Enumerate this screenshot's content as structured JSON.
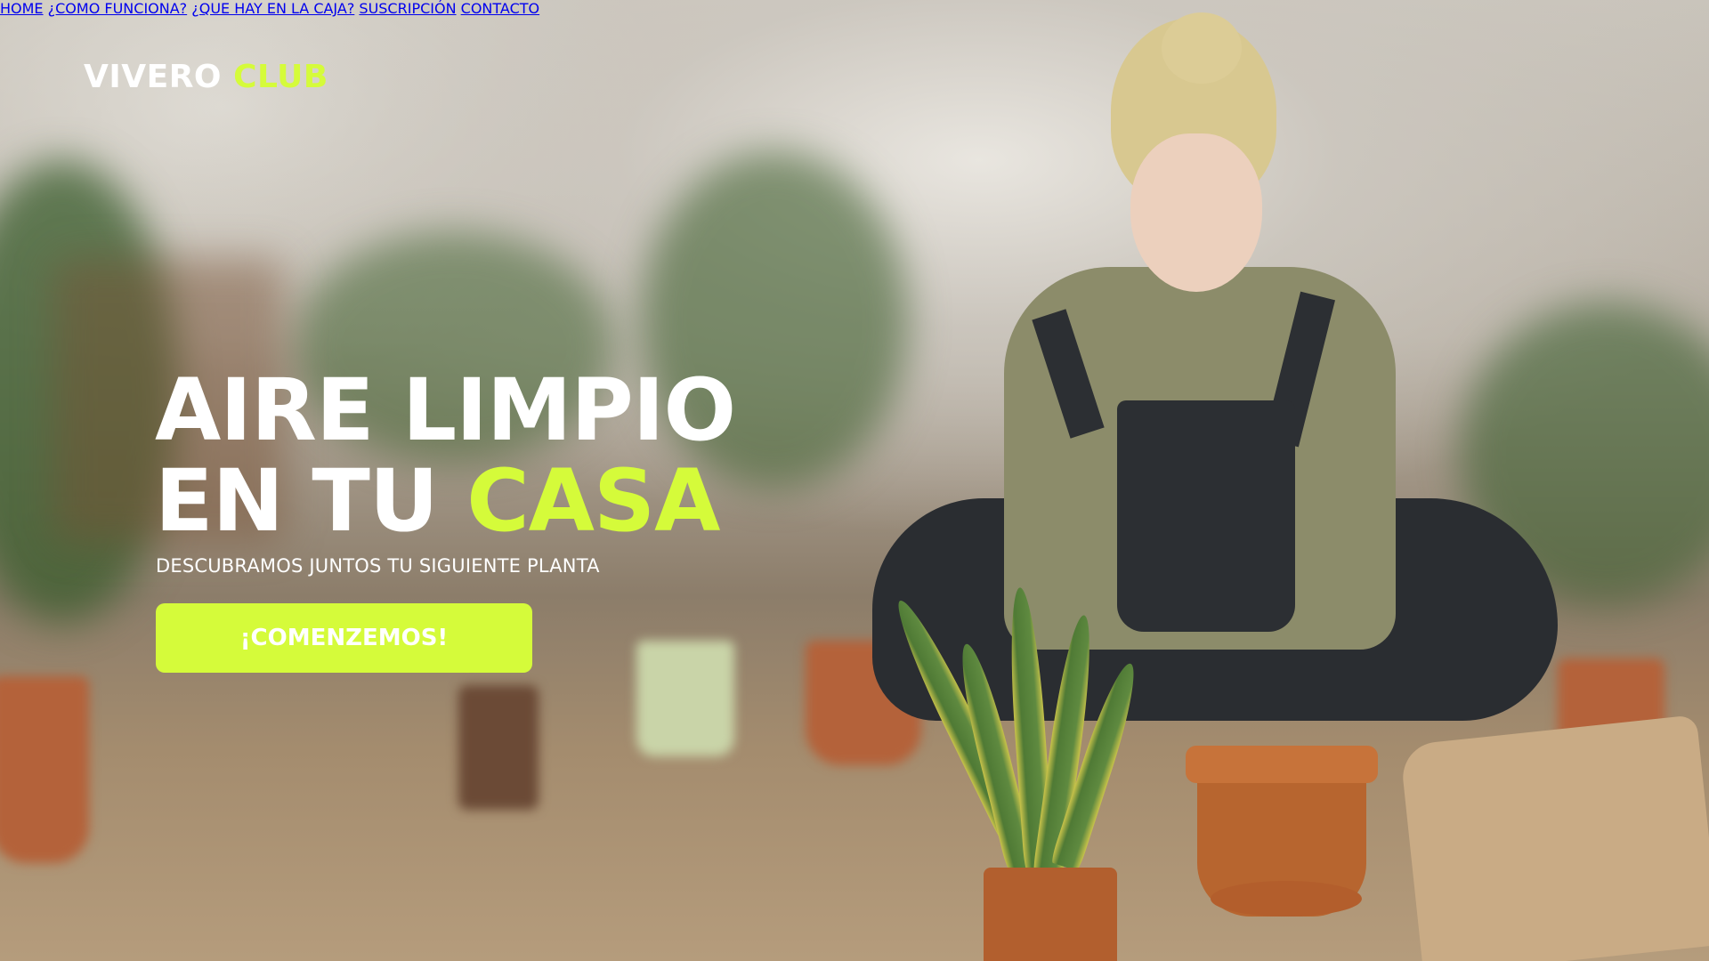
{
  "header": {
    "logo_main": "VIVERO",
    "logo_accent": "CLUB"
  },
  "nav": {
    "items": [
      {
        "label": "HOME"
      },
      {
        "label": "¿COMO FUNCIONA?"
      },
      {
        "label": "¿QUE HAY EN LA CAJA?"
      },
      {
        "label": "SUSCRIPCIÓN"
      },
      {
        "label": "CONTACTO"
      }
    ]
  },
  "hero": {
    "title_line1": "AIRE LIMPIO",
    "title_line2_prefix": "EN TU",
    "title_line2_accent": "CASA",
    "subtitle": "DESCUBRAMOS JUNTOS TU SIGUIENTE PLANTA",
    "cta_label": "¡COMENZEMOS!"
  },
  "colors": {
    "accent": "#d5fb3a",
    "text": "#ffffff"
  }
}
